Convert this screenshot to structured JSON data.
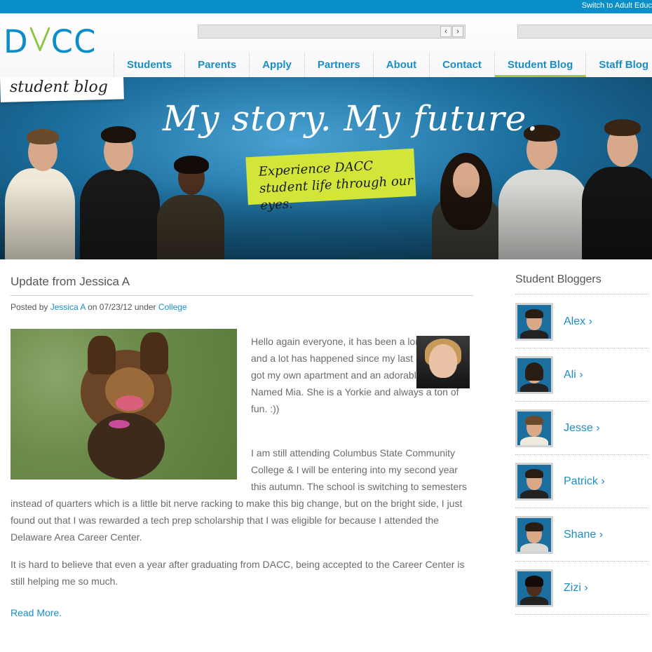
{
  "topbar": {
    "switch_label": "Switch to Adult Educ"
  },
  "header": {
    "logo": {
      "d": "D",
      "cc": "CC",
      "a_hidden": "A"
    }
  },
  "nav": {
    "items": [
      {
        "label": "Students"
      },
      {
        "label": "Parents"
      },
      {
        "label": "Apply"
      },
      {
        "label": "Partners"
      },
      {
        "label": "About"
      },
      {
        "label": "Contact"
      },
      {
        "label": "Student Blog",
        "active": true
      },
      {
        "label": "Staff Blog"
      }
    ]
  },
  "banner": {
    "tag": "student blog",
    "headline": "My story. My future.",
    "sticker": "Experience DACC student life through our eyes."
  },
  "post": {
    "title": "Update from Jessica A",
    "meta": {
      "posted_by_prefix": "Posted by",
      "author": "Jessica A",
      "on_prefix": "on",
      "date": "07/23/12",
      "under_prefix": "under",
      "category": "College"
    },
    "paragraph1": "Hello again everyone, it has been a long time and a lot has happened since my last blog post. I got my own apartment and an adorable puppy Named Mia. She is a Yorkie and always a ton of fun. :))",
    "paragraph2_lines": [
      "I am still attending Columbus State Community",
      "College & I will be entering into my second year",
      "this autumn. The school is switching to semesters",
      "instead of quarters which is a little bit nerve racking to make this big change, but on the bright side, I just",
      "found out that I was rewarded a tech prep scholarship that I was eligible for because I attended the",
      "Delaware Area Career Center."
    ],
    "paragraph3": "It is hard to believe that even a year after graduating from DACC, being accepted to the Career Center is still helping me so much.",
    "read_more": "Read More."
  },
  "sidebar": {
    "title": "Student Bloggers",
    "bloggers": [
      {
        "name": "Alex ›"
      },
      {
        "name": "Ali ›"
      },
      {
        "name": "Jesse ›"
      },
      {
        "name": "Patrick ›"
      },
      {
        "name": "Shane ›"
      },
      {
        "name": "Zizi ›"
      }
    ]
  },
  "colors": {
    "brand_blue": "#0a8ec8",
    "link_blue": "#1a8ec5",
    "accent_green": "#a6c93a",
    "sticker_yellow": "#d2e63a"
  },
  "icons": [
    "chevron-left-icon",
    "chevron-right-icon"
  ]
}
